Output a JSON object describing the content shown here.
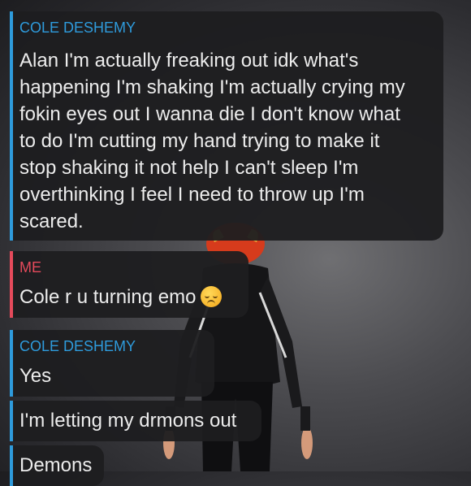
{
  "messages": [
    {
      "sender": "COLE DESHEMY",
      "lines": [
        "Alan I'm actually freaking out idk what's",
        "happening I'm shaking I'm actually crying my",
        "fokin eyes out I wanna die I don't know what",
        "to do I'm cutting my hand trying to make it",
        "stop shaking it not help I can't sleep I'm",
        "overthinking I feel I need to throw up I'm",
        "scared."
      ]
    },
    {
      "sender": "ME",
      "text": "Cole r u turning emo",
      "emoji": "pensive-face-emoji"
    },
    {
      "sender": "COLE DESHEMY",
      "text": "Yes"
    },
    {
      "text": "I'm letting my drmons out"
    },
    {
      "text": "Demons"
    }
  ],
  "colors": {
    "sender_blue": "#2e9bdc",
    "sender_red": "#e44a5b",
    "bubble_bg": "#1e1e20"
  }
}
